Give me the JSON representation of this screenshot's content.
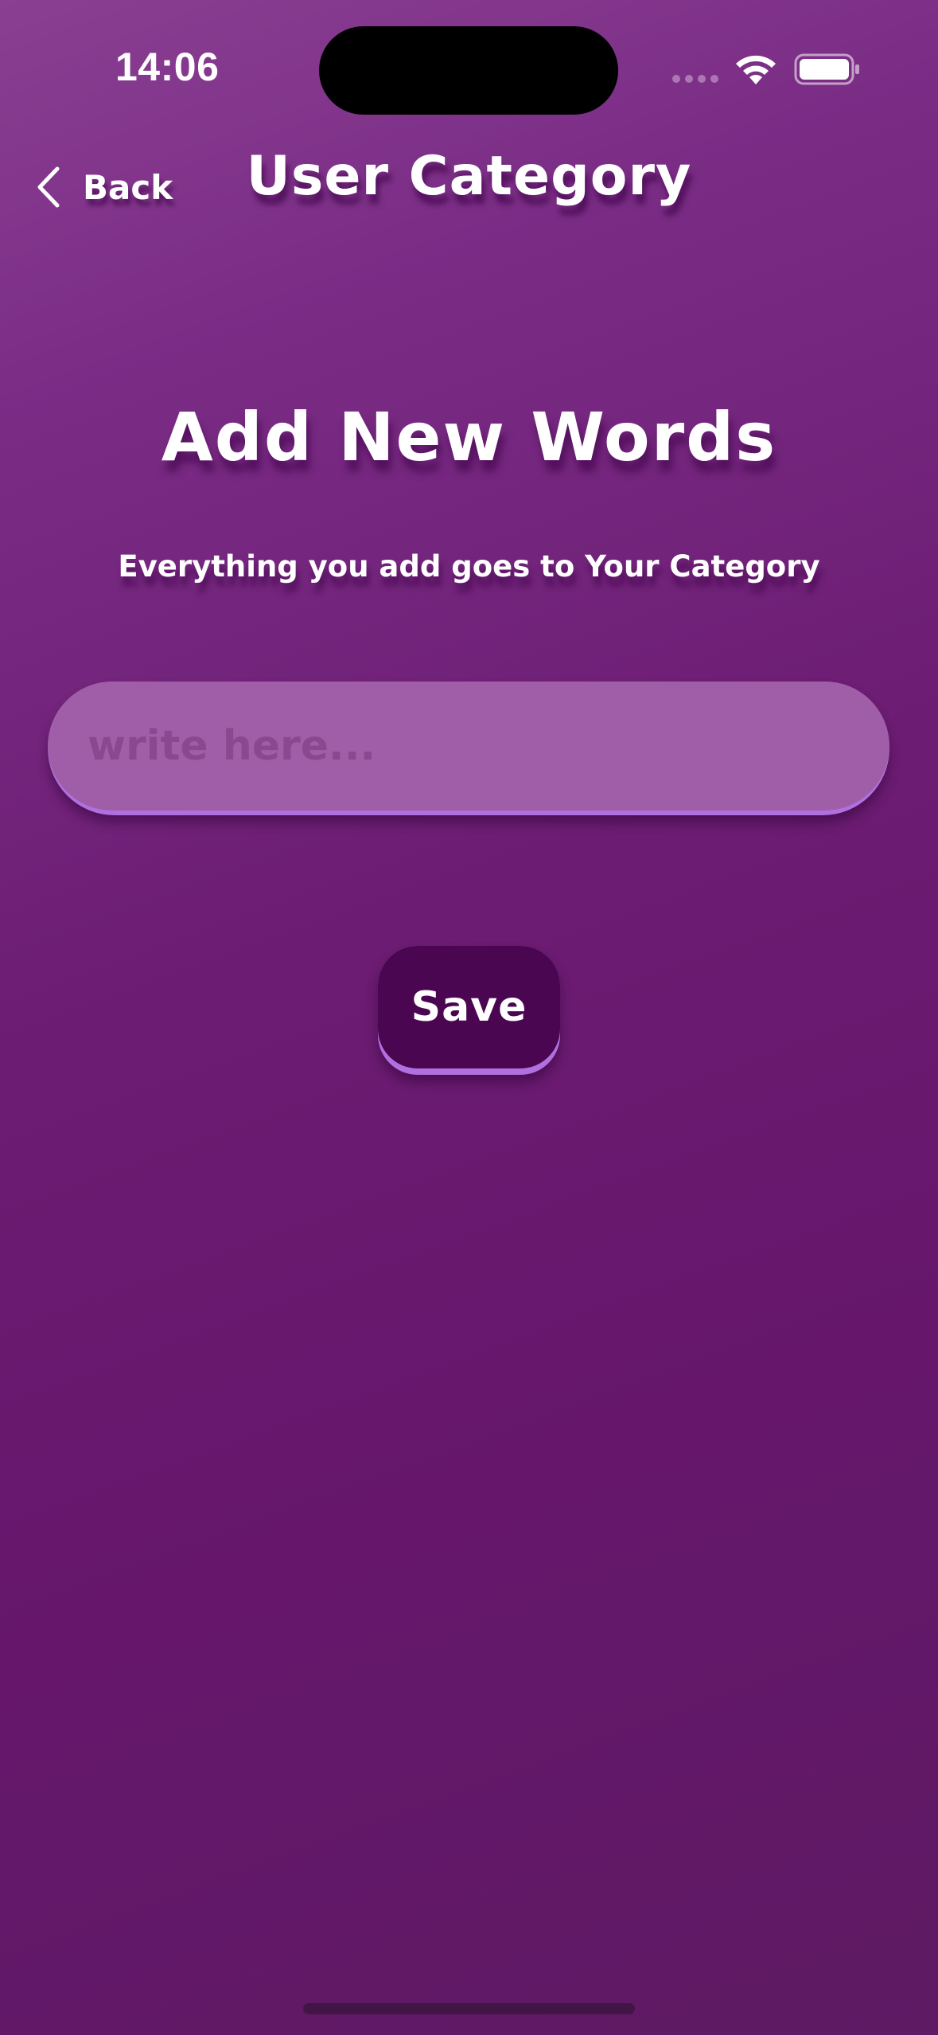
{
  "status_bar": {
    "time": "14:06"
  },
  "nav": {
    "back_label": "Back",
    "title": "User Category"
  },
  "main": {
    "heading": "Add New Words",
    "subtitle": "Everything you add goes to Your Category",
    "input": {
      "value": "",
      "placeholder": "write here..."
    },
    "save_label": "Save"
  },
  "colors": {
    "background": "#6c1c72",
    "input_fill": "#a15ea8",
    "input_edge": "#b070e0",
    "button_fill": "#4a0650"
  },
  "icons": {
    "back": "chevron-left-icon",
    "wifi": "wifi-icon",
    "battery": "battery-icon"
  }
}
